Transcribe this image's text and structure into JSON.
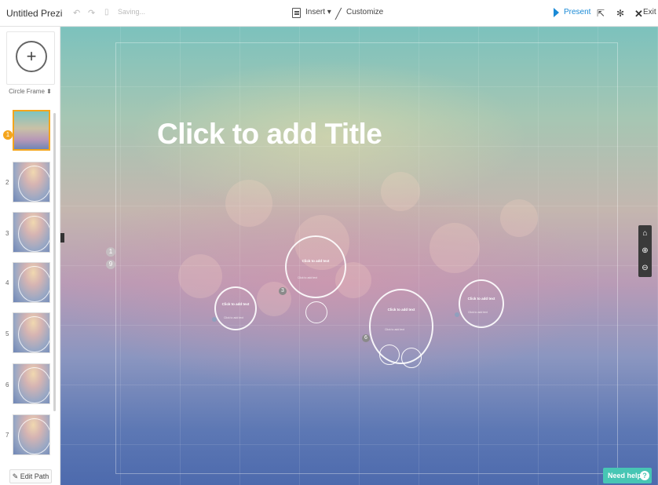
{
  "toolbar": {
    "app_title": "Untitled Prezi",
    "saving_text": "Saving...",
    "insert_label": "Insert ▾",
    "customize_label": "Customize",
    "present_label": "Present",
    "exit_label": "Exit",
    "icons": [
      "undo-icon",
      "redo-icon",
      "save-icon",
      "insert-icon",
      "customize-icon",
      "present-icon",
      "share-icon",
      "gear-icon",
      "exit-icon"
    ]
  },
  "sidebar": {
    "frame_type": "Circle Frame ⬍",
    "add_symbol": "+",
    "thumbnails": [
      "1",
      "2",
      "3",
      "4",
      "5",
      "6",
      "7"
    ],
    "edit_path_label": "✎ Edit Path",
    "active_color": "#f4a51c"
  },
  "canvas": {
    "title": "Click to add Title",
    "path_badges": [
      "1",
      "9"
    ],
    "circles": [
      {
        "title": "Click to add text",
        "badge": "2"
      },
      {
        "title": "Click to add text",
        "badge": "3"
      },
      {
        "title": "Click to add text",
        "badge": "6"
      },
      {
        "title": "Click to add text",
        "badge": "9"
      }
    ],
    "placeholder_sub": "Click to add text"
  },
  "zoom": {
    "home": "⌂",
    "zoom_in": "⊕",
    "zoom_out": "⊖"
  },
  "help": {
    "label": "Need help",
    "icon": "?"
  }
}
